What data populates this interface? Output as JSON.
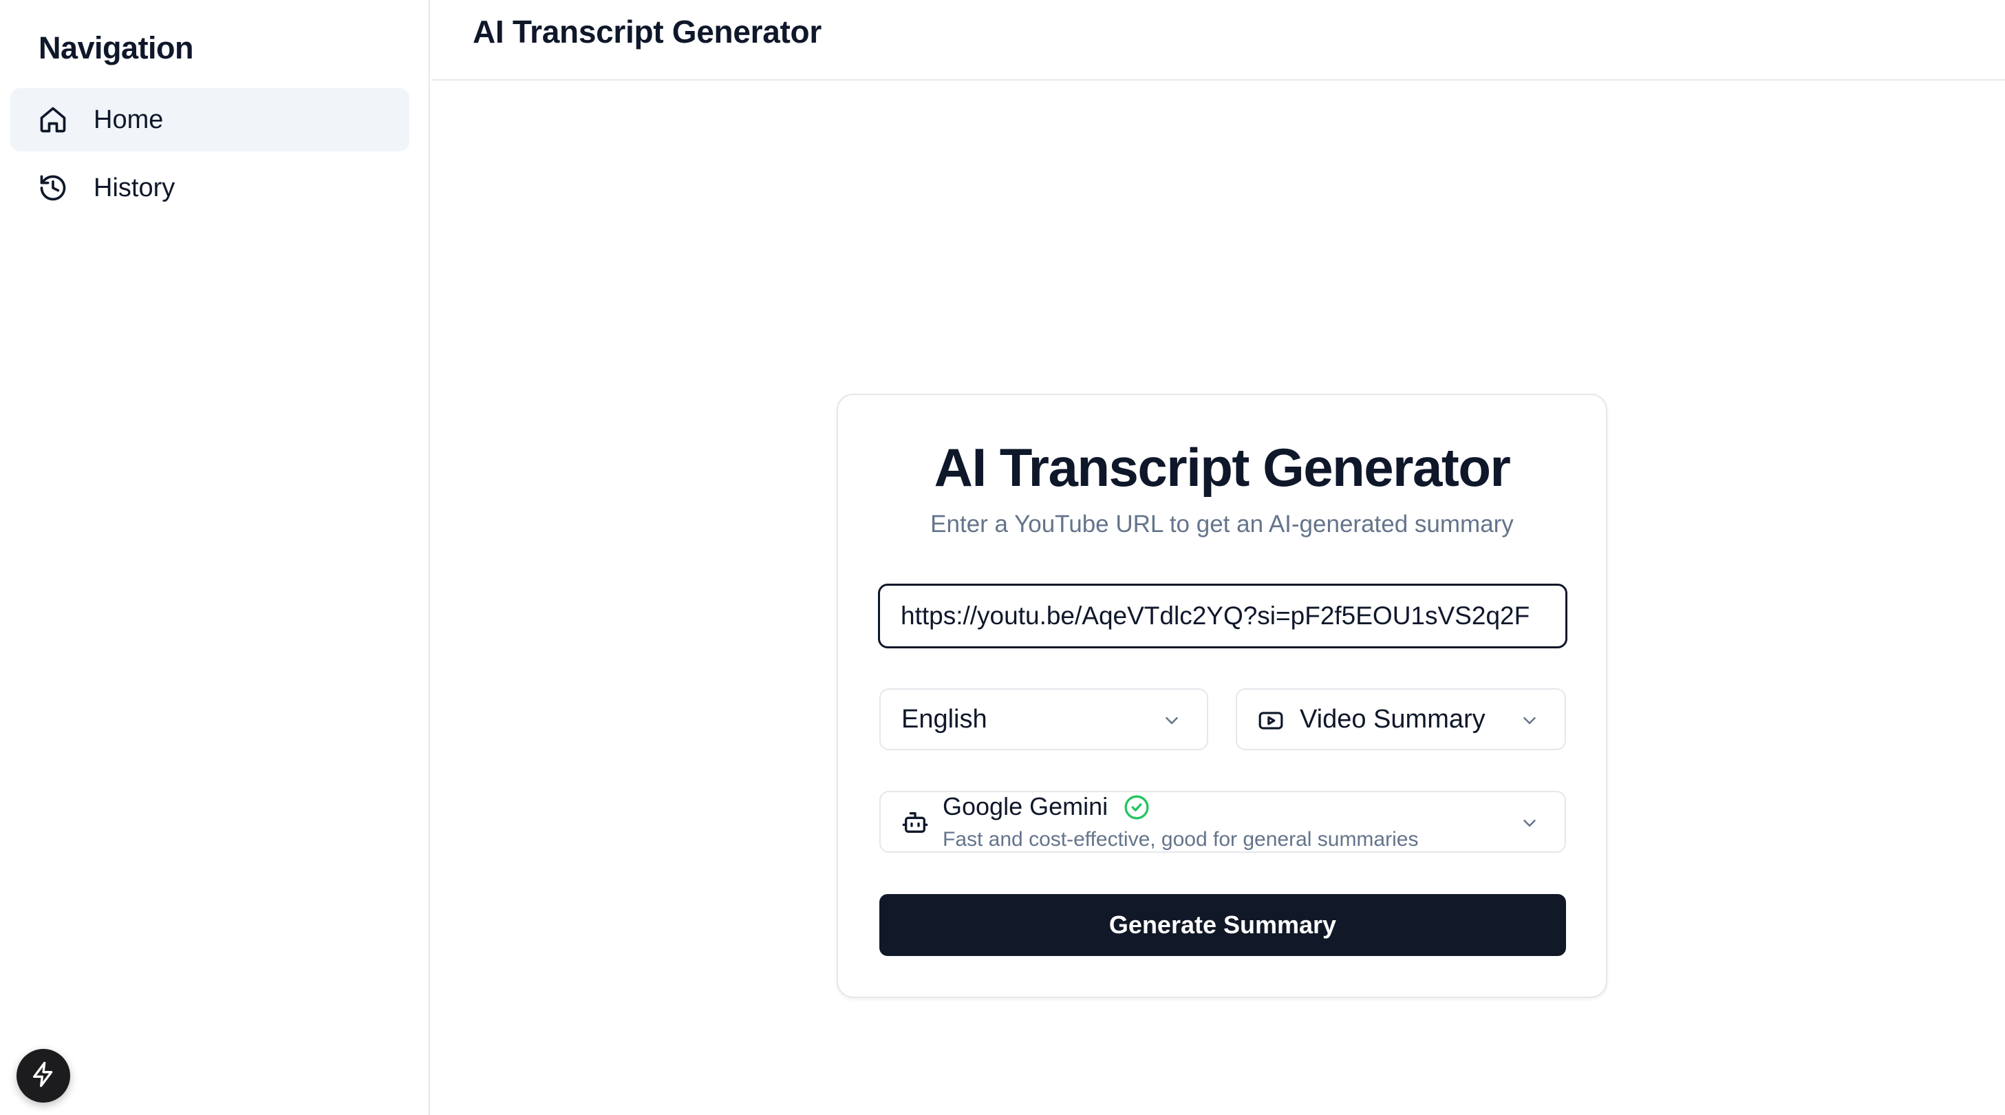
{
  "sidebar": {
    "title": "Navigation",
    "items": [
      {
        "label": "Home",
        "icon": "home-icon",
        "active": true
      },
      {
        "label": "History",
        "icon": "history-icon",
        "active": false
      }
    ],
    "floating_button_icon": "bolt-icon"
  },
  "header": {
    "title": "AI Transcript Generator"
  },
  "main": {
    "card": {
      "title": "AI Transcript Generator",
      "subtitle": "Enter a YouTube URL to get an AI-generated summary",
      "url_input": {
        "value": "https://youtu.be/AqeVTdlc2YQ?si=pF2f5EOU1sVS2q2F",
        "placeholder": ""
      },
      "language_select": {
        "value": "English"
      },
      "type_select": {
        "value": "Video Summary",
        "icon": "video-icon"
      },
      "model_select": {
        "name": "Google Gemini",
        "description": "Fast and cost-effective, good for general summaries",
        "icon": "bot-icon",
        "status_icon": "check-circle-icon"
      },
      "generate_button": {
        "label": "Generate Summary"
      }
    }
  },
  "colors": {
    "primary_button": "#111827",
    "active_nav_bg": "#f1f5f9",
    "muted_text": "#64748b",
    "success": "#22c55e",
    "border": "#e5e7eb"
  }
}
